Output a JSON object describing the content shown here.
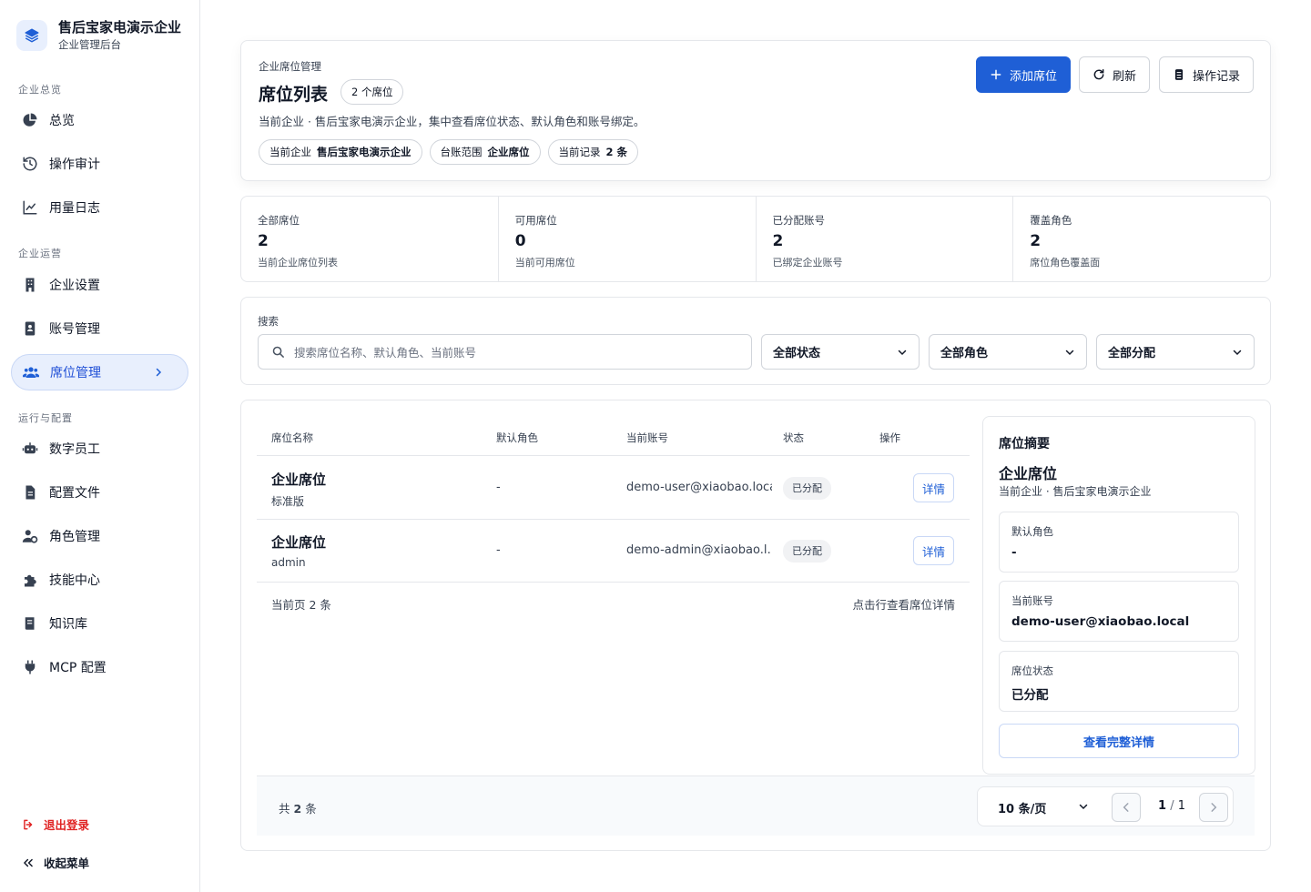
{
  "brand": {
    "name": "售后宝家电演示企业",
    "subtitle": "企业管理后台"
  },
  "sidebar": {
    "sections": [
      {
        "title": "企业总览",
        "items": [
          {
            "label": "总览",
            "icon": "pie-chart-icon"
          },
          {
            "label": "操作审计",
            "icon": "history-icon"
          },
          {
            "label": "用量日志",
            "icon": "line-chart-icon"
          }
        ]
      },
      {
        "title": "企业运营",
        "items": [
          {
            "label": "企业设置",
            "icon": "building-icon"
          },
          {
            "label": "账号管理",
            "icon": "id-card-icon"
          },
          {
            "label": "席位管理",
            "icon": "users-icon",
            "active": true
          }
        ]
      },
      {
        "title": "运行与配置",
        "items": [
          {
            "label": "数字员工",
            "icon": "robot-icon"
          },
          {
            "label": "配置文件",
            "icon": "file-icon"
          },
          {
            "label": "角色管理",
            "icon": "user-cog-icon"
          },
          {
            "label": "技能中心",
            "icon": "puzzle-icon"
          },
          {
            "label": "知识库",
            "icon": "book-icon"
          },
          {
            "label": "MCP 配置",
            "icon": "plug-icon"
          }
        ]
      }
    ],
    "logout": "退出登录",
    "collapse": "收起菜单"
  },
  "header": {
    "eyebrow": "企业席位管理",
    "title": "席位列表",
    "count_pill": "2 个席位",
    "description": "当前企业 · 售后宝家电演示企业，集中查看席位状态、默认角色和账号绑定。",
    "tags": [
      {
        "label": "当前企业",
        "value": "售后宝家电演示企业"
      },
      {
        "label": "台账范围",
        "value": "企业席位"
      },
      {
        "label": "当前记录",
        "value": "2 条"
      }
    ],
    "buttons": {
      "add": "添加席位",
      "refresh": "刷新",
      "log": "操作记录"
    }
  },
  "stats": [
    {
      "label": "全部席位",
      "value": "2",
      "sub": "当前企业席位列表"
    },
    {
      "label": "可用席位",
      "value": "0",
      "sub": "当前可用席位"
    },
    {
      "label": "已分配账号",
      "value": "2",
      "sub": "已绑定企业账号"
    },
    {
      "label": "覆盖角色",
      "value": "2",
      "sub": "席位角色覆盖面"
    }
  ],
  "search": {
    "label": "搜索",
    "placeholder": "搜索席位名称、默认角色、当前账号",
    "filters": [
      "全部状态",
      "全部角色",
      "全部分配"
    ]
  },
  "table": {
    "columns": [
      "席位名称",
      "默认角色",
      "当前账号",
      "状态",
      "操作"
    ],
    "rows": [
      {
        "name": "企业席位",
        "sub": "标准版",
        "role": "-",
        "account": "demo-user@xiaobao.local",
        "status": "已分配",
        "action": "详情"
      },
      {
        "name": "企业席位",
        "sub": "admin",
        "role": "-",
        "account": "demo-admin@xiaobao.l…",
        "status": "已分配",
        "action": "详情"
      }
    ],
    "footer_left": "当前页 2 条",
    "footer_right": "点击行查看席位详情"
  },
  "summary": {
    "title": "席位摘要",
    "name": "企业席位",
    "sub": "当前企业 · 售后宝家电演示企业",
    "fields": [
      {
        "label": "默认角色",
        "value": "-"
      },
      {
        "label": "当前账号",
        "value": "demo-user@xiaobao.local"
      },
      {
        "label": "席位状态",
        "value": "已分配"
      }
    ],
    "button": "查看完整详情"
  },
  "pagination": {
    "total_prefix": "共",
    "total": "2",
    "total_suffix": "条",
    "page_size": "10 条/页",
    "current": "1",
    "sep": "/",
    "pages": "1"
  },
  "colors": {
    "accent": "#1f5fd6",
    "active_bg": "#e8effd",
    "danger": "#e02424"
  }
}
